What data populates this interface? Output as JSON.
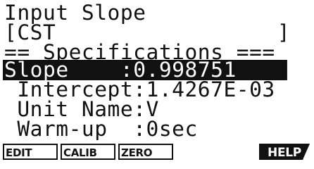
{
  "screen": {
    "title": "Input Slope",
    "value_open": "[CST",
    "value_close": "]",
    "section_header": "== Specifications ==="
  },
  "specs": {
    "slope": {
      "label": "Slope",
      "colon": ":",
      "value": "0.998751"
    },
    "intercept": {
      "label": "Intercept",
      "colon": ":",
      "value": "1.4267E-03"
    },
    "unit_name": {
      "label": "Unit Name",
      "colon": ":",
      "value": "V"
    },
    "warm_up": {
      "label": "Warm-up",
      "colon": ":",
      "value": "0sec"
    }
  },
  "function_keys": {
    "f1": "EDIT",
    "f2": "CALIB",
    "f3": "ZERO",
    "f6": "HELP"
  },
  "colors": {
    "foreground": "#111111",
    "background": "#ffffff",
    "highlight": "#111111"
  }
}
